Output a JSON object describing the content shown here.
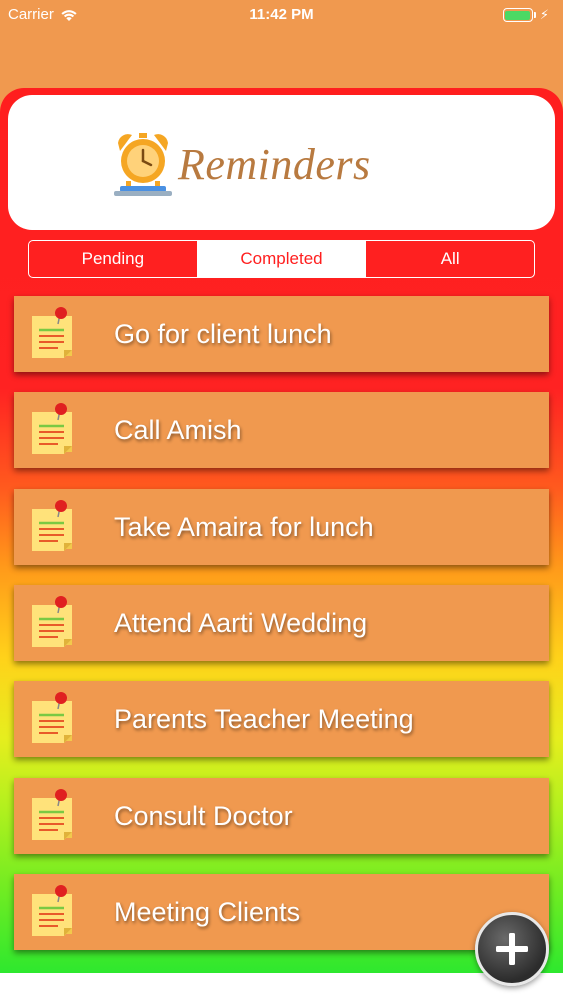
{
  "status_bar": {
    "carrier": "Carrier",
    "time": "11:42 PM"
  },
  "header": {
    "title": "Reminders",
    "logo_icon": "alarm-clock-icon"
  },
  "tabs": [
    {
      "label": "Pending",
      "active": false
    },
    {
      "label": "Completed",
      "active": true
    },
    {
      "label": "All",
      "active": false
    }
  ],
  "reminders": [
    {
      "title": "Go for client lunch",
      "icon": "sticky-note-icon"
    },
    {
      "title": "Call Amish",
      "icon": "sticky-note-icon"
    },
    {
      "title": "Take Amaira for lunch",
      "icon": "sticky-note-icon"
    },
    {
      "title": "Attend Aarti Wedding",
      "icon": "sticky-note-icon"
    },
    {
      "title": "Parents Teacher Meeting",
      "icon": "sticky-note-icon"
    },
    {
      "title": "Consult Doctor",
      "icon": "sticky-note-icon"
    },
    {
      "title": "Meeting Clients",
      "icon": "sticky-note-icon"
    }
  ],
  "add_button": {
    "icon": "plus-icon"
  },
  "colors": {
    "background": "#F0994F",
    "accent_red": "#FF1E1E",
    "title_brown": "#B87A40",
    "battery_green": "#4CD964"
  }
}
